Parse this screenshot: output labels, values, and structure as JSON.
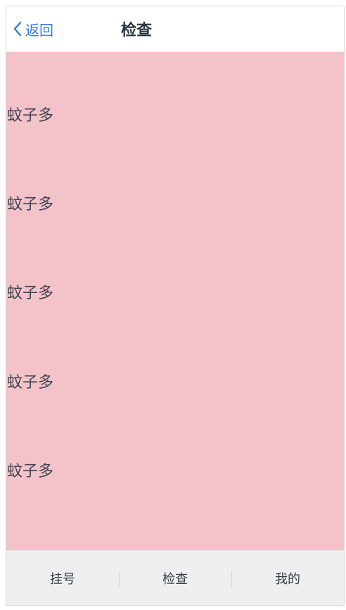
{
  "header": {
    "back_label": "返回",
    "title": "检查"
  },
  "content": {
    "items": [
      {
        "label": "蚊子多"
      },
      {
        "label": "蚊子多"
      },
      {
        "label": "蚊子多"
      },
      {
        "label": "蚊子多"
      },
      {
        "label": "蚊子多"
      }
    ]
  },
  "tabbar": {
    "tabs": [
      {
        "label": "挂号"
      },
      {
        "label": "检查"
      },
      {
        "label": "我的"
      }
    ]
  },
  "colors": {
    "accent": "#2f7ce6",
    "content_background": "#f4c3ca",
    "tabbar_background": "#efefef"
  },
  "icons": {
    "back": "chevron-left-icon"
  }
}
